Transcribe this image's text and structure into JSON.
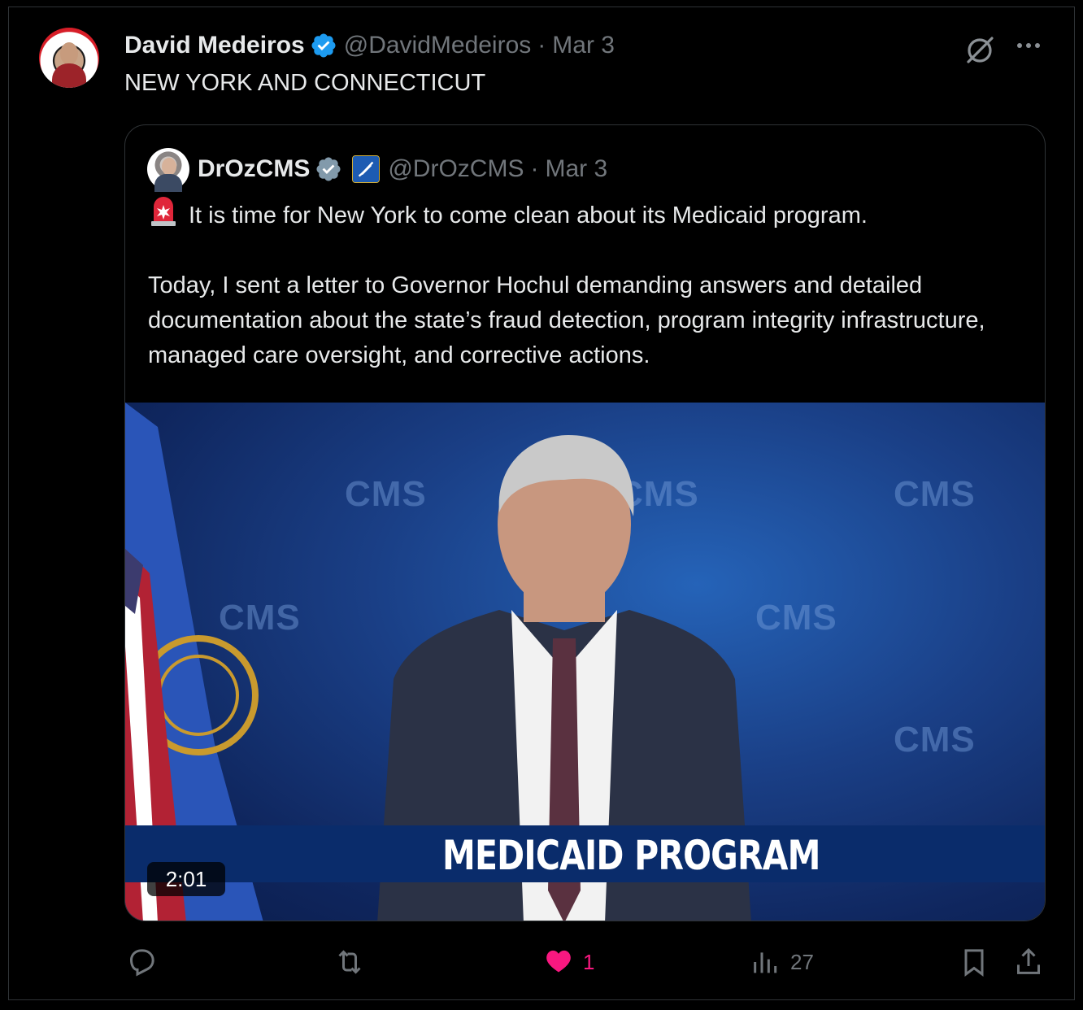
{
  "post": {
    "author_name": "David Medeiros",
    "handle": "@DavidMedeiros",
    "separator": "·",
    "date": "Mar 3",
    "text": "NEW YORK AND CONNECTICUT"
  },
  "quote": {
    "author_name": "DrOzCMS",
    "handle": "@DrOzCMS",
    "separator": "·",
    "date": "Mar 3",
    "line1": "It is time for New York to come clean about its Medicaid program.",
    "paragraph2": "Today, I sent a letter to Governor Hochul demanding answers and detailed documentation about the state’s fraud detection, program integrity infrastructure, managed care oversight, and corrective actions.",
    "video": {
      "banner_text": "MEDICAID PROGRAM",
      "duration": "2:01",
      "background_logo": "CMS"
    }
  },
  "actions": {
    "reply": {
      "icon": "reply-icon",
      "count": ""
    },
    "repost": {
      "icon": "repost-icon",
      "count": ""
    },
    "like": {
      "icon": "heart-icon",
      "count": "1",
      "color": "#f91880"
    },
    "views": {
      "icon": "views-icon",
      "count": "27"
    },
    "bookmark": {
      "icon": "bookmark-icon"
    },
    "share": {
      "icon": "share-icon"
    }
  },
  "colors": {
    "background": "#000000",
    "text_primary": "#e7e9ea",
    "text_secondary": "#71767b",
    "verified": "#1d9bf0",
    "border": "#2f3336"
  }
}
